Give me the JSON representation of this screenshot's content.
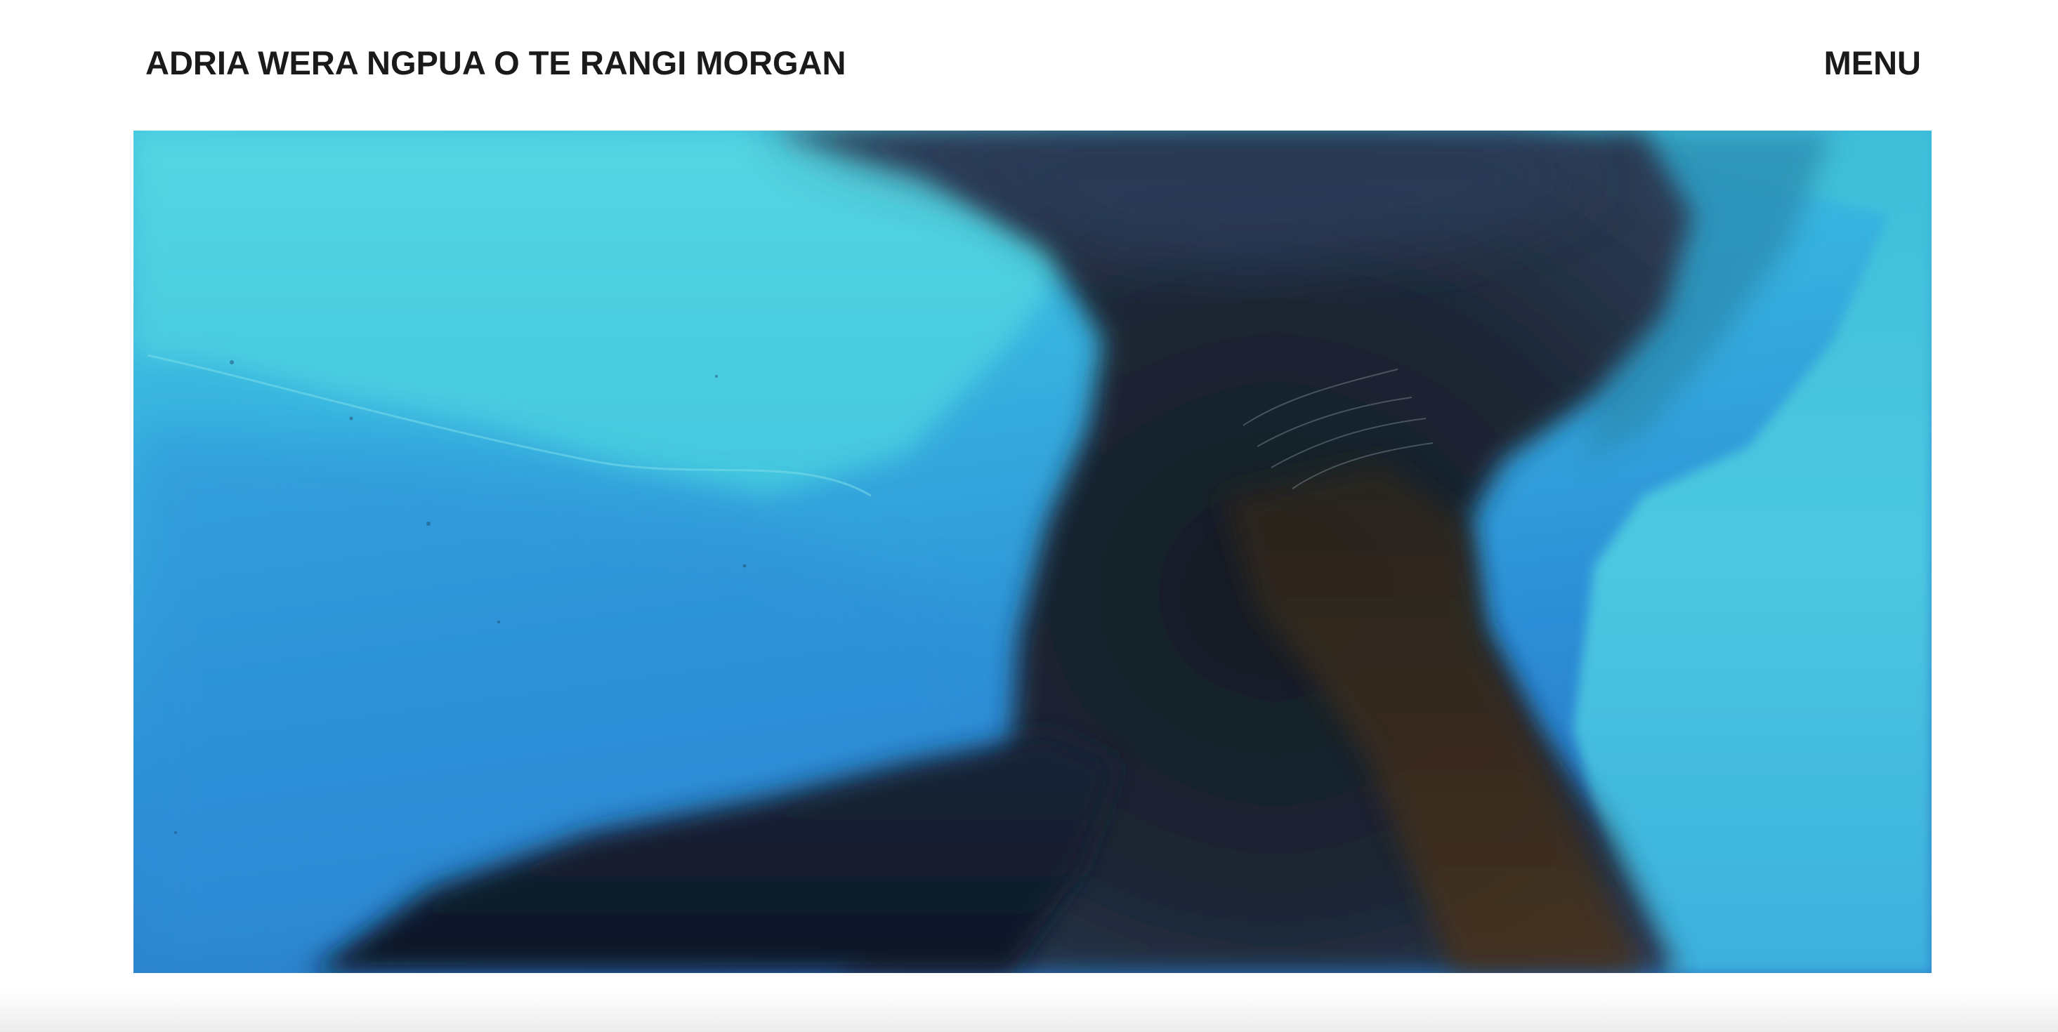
{
  "header": {
    "site_title": "ADRIA WERA NGPUA O TE RANGI MORGAN",
    "menu_label": "MENU"
  },
  "hero": {
    "image_alt": "Abstract fluid painting in turquoise and blue with a dark navy and brown central form",
    "colors": {
      "turquoise": "#4fd1dc",
      "blue": "#2f8fd6",
      "navy": "#0e1a2e",
      "brown": "#3a2a1c"
    }
  }
}
